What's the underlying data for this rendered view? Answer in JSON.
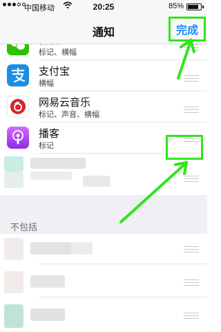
{
  "status_bar": {
    "carrier": "中国移动",
    "time": "20:25",
    "battery_percent": "85%",
    "battery_level": 0.85
  },
  "nav": {
    "title": "通知",
    "done_label": "完成"
  },
  "apps": [
    {
      "name": "微信",
      "subtitle": "标记、横幅",
      "icon": "wechat-icon"
    },
    {
      "name": "支付宝",
      "subtitle": "横幅",
      "icon": "alipay-icon"
    },
    {
      "name": "网易云音乐",
      "subtitle": "标记、声音、横幅",
      "icon": "netease-music-icon"
    },
    {
      "name": "播客",
      "subtitle": "标记",
      "icon": "podcast-icon"
    }
  ],
  "section": {
    "not_included_label": "不包括"
  },
  "colors": {
    "annotation": "#2fe51c",
    "link_blue": "#1a8cff"
  }
}
